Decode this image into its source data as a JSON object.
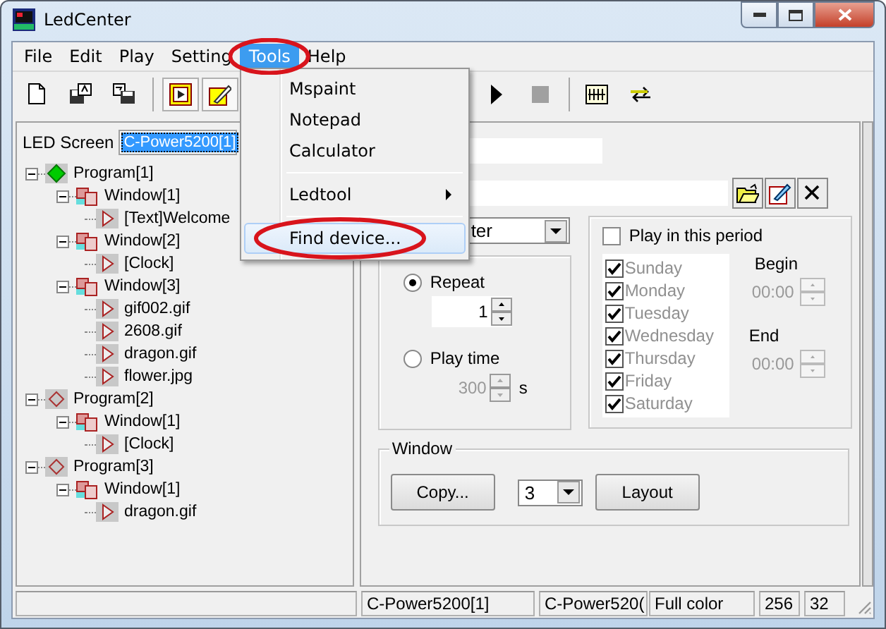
{
  "window": {
    "title": "LedCenter"
  },
  "menu": [
    {
      "label": "File",
      "selected": false,
      "circled": false
    },
    {
      "label": "Edit",
      "selected": false,
      "circled": false
    },
    {
      "label": "Play",
      "selected": false,
      "circled": false
    },
    {
      "label": "Setting",
      "selected": false,
      "circled": false
    },
    {
      "label": "Tools",
      "selected": true,
      "circled": true
    },
    {
      "label": "Help",
      "selected": false,
      "circled": false
    }
  ],
  "dropdown_menu": [
    {
      "kind": "item",
      "label": "Mspaint",
      "selected": false,
      "circled": false
    },
    {
      "kind": "item",
      "label": "Notepad",
      "selected": false,
      "circled": false
    },
    {
      "kind": "item",
      "label": "Calculator",
      "selected": false,
      "circled": false
    },
    {
      "kind": "separator"
    },
    {
      "kind": "submenu",
      "label": "Ledtool",
      "selected": false,
      "circled": false
    },
    {
      "kind": "separator"
    },
    {
      "kind": "item",
      "label": "Find device...",
      "selected": true,
      "circled": true
    }
  ],
  "led_screen": {
    "label": "LED Screen",
    "value": "C-Power5200[1]"
  },
  "tree": [
    {
      "kind": "program",
      "label": "Program[1]",
      "active": true,
      "expanded": true,
      "children": [
        {
          "kind": "window",
          "label": "Window[1]",
          "expanded": true,
          "children": [
            {
              "kind": "item",
              "label": "[Text]Welcome"
            }
          ]
        },
        {
          "kind": "window",
          "label": "Window[2]",
          "expanded": true,
          "children": [
            {
              "kind": "item",
              "label": "[Clock]"
            }
          ]
        },
        {
          "kind": "window",
          "label": "Window[3]",
          "expanded": true,
          "children": [
            {
              "kind": "item",
              "label": "gif002.gif"
            },
            {
              "kind": "item",
              "label": "2608.gif"
            },
            {
              "kind": "item",
              "label": "dragon.gif"
            },
            {
              "kind": "item",
              "label": "flower.jpg"
            }
          ]
        }
      ]
    },
    {
      "kind": "program",
      "label": "Program[2]",
      "active": false,
      "expanded": true,
      "children": [
        {
          "kind": "window",
          "label": "Window[1]",
          "expanded": true,
          "children": [
            {
              "kind": "item",
              "label": "[Clock]"
            }
          ]
        }
      ]
    },
    {
      "kind": "program",
      "label": "Program[3]",
      "active": false,
      "expanded": true,
      "children": [
        {
          "kind": "window",
          "label": "Window[1]",
          "expanded": true,
          "children": [
            {
              "kind": "item",
              "label": "dragon.gif"
            }
          ]
        }
      ]
    }
  ],
  "properties": {
    "mode_value": "ter",
    "play_mode": [
      {
        "label": "Repeat",
        "selected": true,
        "value": "1",
        "disabled": false
      },
      {
        "label": "Play time",
        "selected": false,
        "value": "300",
        "unit": "s",
        "disabled": true
      }
    ],
    "period": {
      "label": "Play in this period",
      "checked": false,
      "disabled": true,
      "days": [
        {
          "label": "Sunday",
          "checked": true
        },
        {
          "label": "Monday",
          "checked": true
        },
        {
          "label": "Tuesday",
          "checked": true
        },
        {
          "label": "Wednesday",
          "checked": true
        },
        {
          "label": "Thursday",
          "checked": true
        },
        {
          "label": "Friday",
          "checked": true
        },
        {
          "label": "Saturday",
          "checked": true
        }
      ],
      "begin_label": "Begin",
      "begin": "00:00",
      "end_label": "End",
      "end": "00:00"
    },
    "window_group": {
      "title": "Window",
      "copy_button": "Copy...",
      "count": "3",
      "layout_button": "Layout"
    }
  },
  "status_bar": [
    "C-Power5200[1]",
    "C-Power520(",
    "Full color",
    "256",
    "32"
  ]
}
